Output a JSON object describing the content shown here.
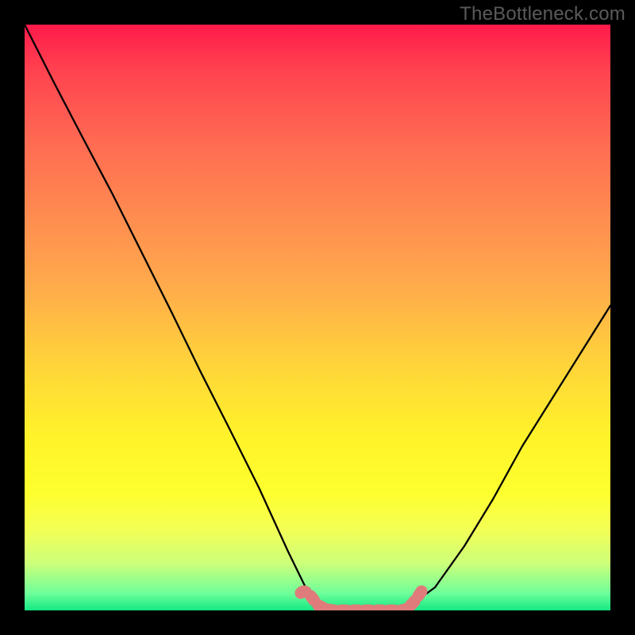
{
  "attribution": "TheBottleneck.com",
  "chart_data": {
    "type": "line",
    "title": "",
    "xlabel": "",
    "ylabel": "",
    "xlim": [
      0,
      100
    ],
    "ylim": [
      0,
      100
    ],
    "series": [
      {
        "name": "bottleneck-curve",
        "x": [
          0,
          5,
          10,
          15,
          20,
          25,
          30,
          35,
          40,
          45,
          48,
          50,
          53,
          56,
          60,
          64,
          66,
          70,
          75,
          80,
          85,
          90,
          95,
          100
        ],
        "y": [
          100,
          90,
          80.5,
          71,
          61,
          51,
          41,
          31,
          21,
          10,
          4,
          1,
          0,
          0,
          0,
          0,
          1,
          4,
          11,
          19,
          28,
          36,
          44,
          52
        ]
      }
    ],
    "markers": {
      "name": "highlight-band",
      "style": "dashed-pill",
      "color": "#e07b7b",
      "points_x": [
        48,
        50,
        53,
        56,
        60,
        64,
        66
      ],
      "points_y": [
        4,
        1,
        0,
        0,
        0,
        0,
        1
      ]
    },
    "gradient_stops": [
      {
        "pos": 0,
        "color": "#ff1a4b"
      },
      {
        "pos": 8,
        "color": "#ff4350"
      },
      {
        "pos": 20,
        "color": "#ff6a52"
      },
      {
        "pos": 32,
        "color": "#ff8a50"
      },
      {
        "pos": 44,
        "color": "#ffa94c"
      },
      {
        "pos": 58,
        "color": "#ffd43a"
      },
      {
        "pos": 70,
        "color": "#fff22a"
      },
      {
        "pos": 80,
        "color": "#feff2e"
      },
      {
        "pos": 86,
        "color": "#f4ff54"
      },
      {
        "pos": 92,
        "color": "#ccff7a"
      },
      {
        "pos": 97,
        "color": "#70ff9a"
      },
      {
        "pos": 100,
        "color": "#13e884"
      }
    ]
  }
}
